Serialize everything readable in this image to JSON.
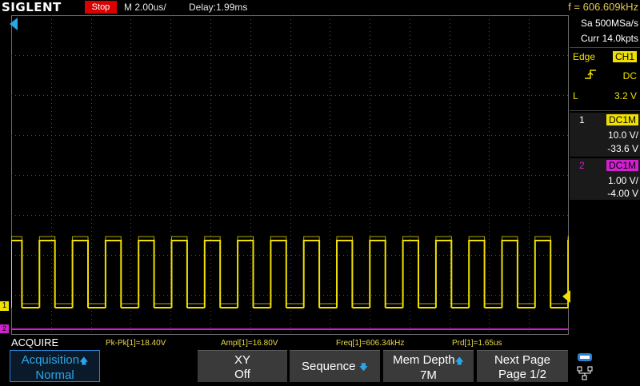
{
  "topbar": {
    "logo": "SIGLENT",
    "run_status": "Stop",
    "timebase": "M 2.00us/",
    "delay": "Delay:1.99ms",
    "frequency": "f = 606.609kHz"
  },
  "acquisition_info": {
    "sample_rate": "Sa 500MSa/s",
    "current_points": "Curr 14.0kpts"
  },
  "trigger": {
    "type": "Edge",
    "source": "CH1",
    "coupling": "DC",
    "level_label": "L",
    "level_value": "3.2 V"
  },
  "channels": [
    {
      "number": "1",
      "coupling": "DC1M",
      "scale": "10.0 V/",
      "offset": "-33.6 V",
      "color": "#f0e000"
    },
    {
      "number": "2",
      "coupling": "DC1M",
      "scale": "1.00 V/",
      "offset": "-4.00 V",
      "color": "#d020d0"
    }
  ],
  "waveform_markers": {
    "ch1_marker": "1",
    "ch2_marker": "2"
  },
  "menu_title": "ACQUIRE",
  "measurements": [
    "Pk-Pk[1]=18.40V",
    "Ampl[1]=16.80V",
    "Freq[1]=606.34kHz",
    "Prd[1]=1.65us"
  ],
  "softkeys": [
    {
      "line1": "Acquisition",
      "line2": "Normal"
    },
    {
      "line1": "XY",
      "line2": "Off"
    },
    {
      "line1": "Sequence",
      "line2": ""
    },
    {
      "line1": "Mem Depth",
      "line2": "7M"
    },
    {
      "line1": "Next Page",
      "line2": "Page 1/2"
    }
  ],
  "colors": {
    "ch1": "#f0e000",
    "ch2": "#d020d0",
    "accent": "#2aa6e8",
    "stop": "#d90000"
  }
}
